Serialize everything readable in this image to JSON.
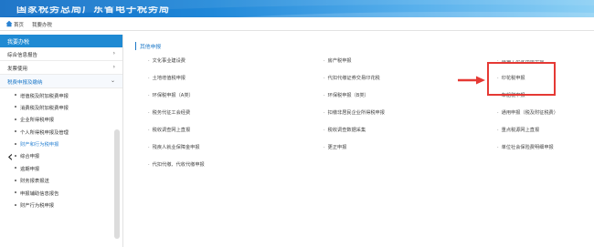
{
  "banner": {
    "title": "国家税务总局广东省电子税务局"
  },
  "breadcrumb": {
    "home": "首页",
    "current": "我要办税"
  },
  "sidebar": {
    "header": "我要办税",
    "groups": [
      {
        "label": "综合信息报告"
      },
      {
        "label": "发票使用"
      },
      {
        "label": "税费申报及缴纳"
      }
    ],
    "items": [
      {
        "label": "增值税及附加税费申报"
      },
      {
        "label": "消费税及附加税费申报"
      },
      {
        "label": "企业所得税申报"
      },
      {
        "label": "个人所得税申报及管理"
      },
      {
        "label": "财产和行为税申报"
      },
      {
        "label": "综合申报"
      },
      {
        "label": "逾期申报"
      },
      {
        "label": "财务报表报送"
      },
      {
        "label": "申报辅助信息报告"
      },
      {
        "label": "财产行为税申报"
      }
    ],
    "active_item_index": 4
  },
  "content": {
    "section_title": "其他申报",
    "columns": [
      [
        "文化事业建设费",
        "土地增值税申报",
        "环保税申报（A类）",
        "税务代征工会经费",
        "税收调查网上直报",
        "残疾人就业保障金申报",
        "代扣代缴、代收代缴申报"
      ],
      [
        "房产税申报",
        "代扣代缴证券交易印花税",
        "环保税申报（B类）",
        "扣缴非居民企业所得税申报",
        "税收调查数据采集",
        "更正申报"
      ],
      [
        "城镇土地使用税申报",
        "印花税申报",
        "车船税申报",
        "通用申报（税及附征税费）",
        "重点税源网上直报",
        "单位社会保险费明细申报"
      ]
    ]
  },
  "annotation": {
    "highlighted_item": "印花税申报",
    "highlight_color": "#e53934"
  }
}
